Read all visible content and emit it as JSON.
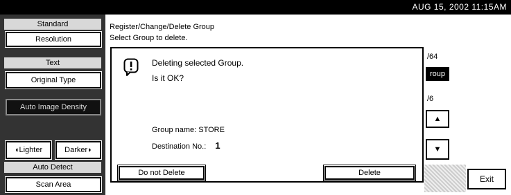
{
  "status_bar": {
    "datetime": "AUG 15, 2002 11:15AM"
  },
  "left_panel": {
    "standard_label": "Standard",
    "resolution_button": "Resolution",
    "text_label": "Text",
    "original_type_button": "Original Type",
    "auto_density_button": "Auto Image Density",
    "lighter_button": "Lighter",
    "darker_button": "Darker",
    "auto_detect_label": "Auto Detect",
    "scan_area_button": "Scan Area"
  },
  "main": {
    "title": "Register/Change/Delete Group",
    "subtitle": "Select Group to delete.",
    "page_count_1": "/64",
    "group_button": "roup",
    "page_count_2": "/6",
    "exit_button": "Exit"
  },
  "dialog": {
    "message_line1": "Deleting selected Group.",
    "message_line2": "Is it OK?",
    "group_name_line": "Group name: STORE",
    "destination_label": "Destination No.:",
    "destination_value": "1",
    "do_not_delete_button": "Do not Delete",
    "delete_button": "Delete",
    "icon": "warning-icon"
  }
}
